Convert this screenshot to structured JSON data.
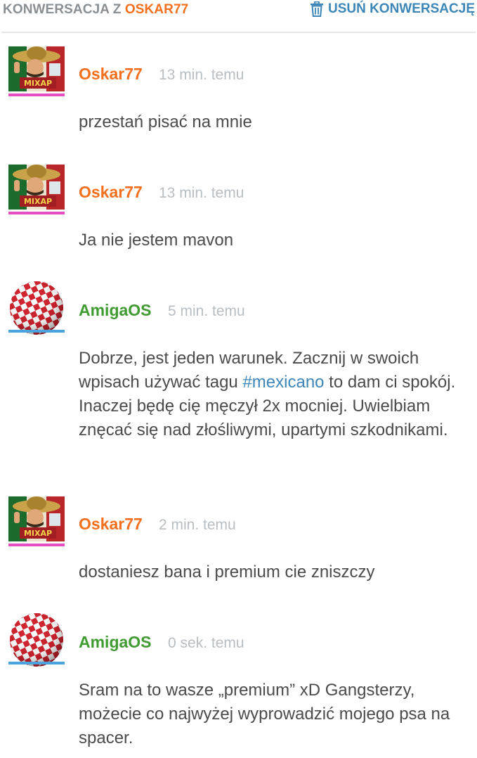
{
  "header": {
    "title_prefix": "KONWERSACJA Z",
    "title_user": "OSKAR77",
    "delete_label": "USUŃ KONWERSACJĘ"
  },
  "colors": {
    "orange": "#f5701e",
    "green": "#3f9c30",
    "link_blue": "#3d86b8",
    "pink_line": "#e64fc1",
    "blue_line": "#4aa3dc",
    "muted": "#b9bec2"
  },
  "messages": [
    {
      "author": "Oskar77",
      "time": "13 min. temu",
      "text": "przestań pisać na mnie",
      "avatar": "mexican-avatar-icon"
    },
    {
      "author": "Oskar77",
      "time": "13 min. temu",
      "text": "Ja nie jestem mavon",
      "avatar": "mexican-avatar-icon"
    },
    {
      "author": "AmigaOS",
      "time": "5 min. temu",
      "text_before": "Dobrze, jest jeden warunek. Zacznij w swoich wpisach używać tagu ",
      "tag": "#mexicano",
      "text_after": " to dam ci spokój. Inaczej będę cię męczył 2x mocniej. Uwielbiam znęcać się nad złośliwymi, upartymi szkodnikami.",
      "avatar": "amiga-ball-avatar-icon"
    },
    {
      "author": "Oskar77",
      "time": "2 min. temu",
      "text": "dostaniesz bana i premium cie zniszczy",
      "avatar": "mexican-avatar-icon"
    },
    {
      "author": "AmigaOS",
      "time": "0 sek. temu",
      "text": "Sram na to wasze „premium” xD Gangsterzy, możecie co najwyżej wyprowadzić mojego psa na spacer.",
      "avatar": "amiga-ball-avatar-icon"
    }
  ]
}
